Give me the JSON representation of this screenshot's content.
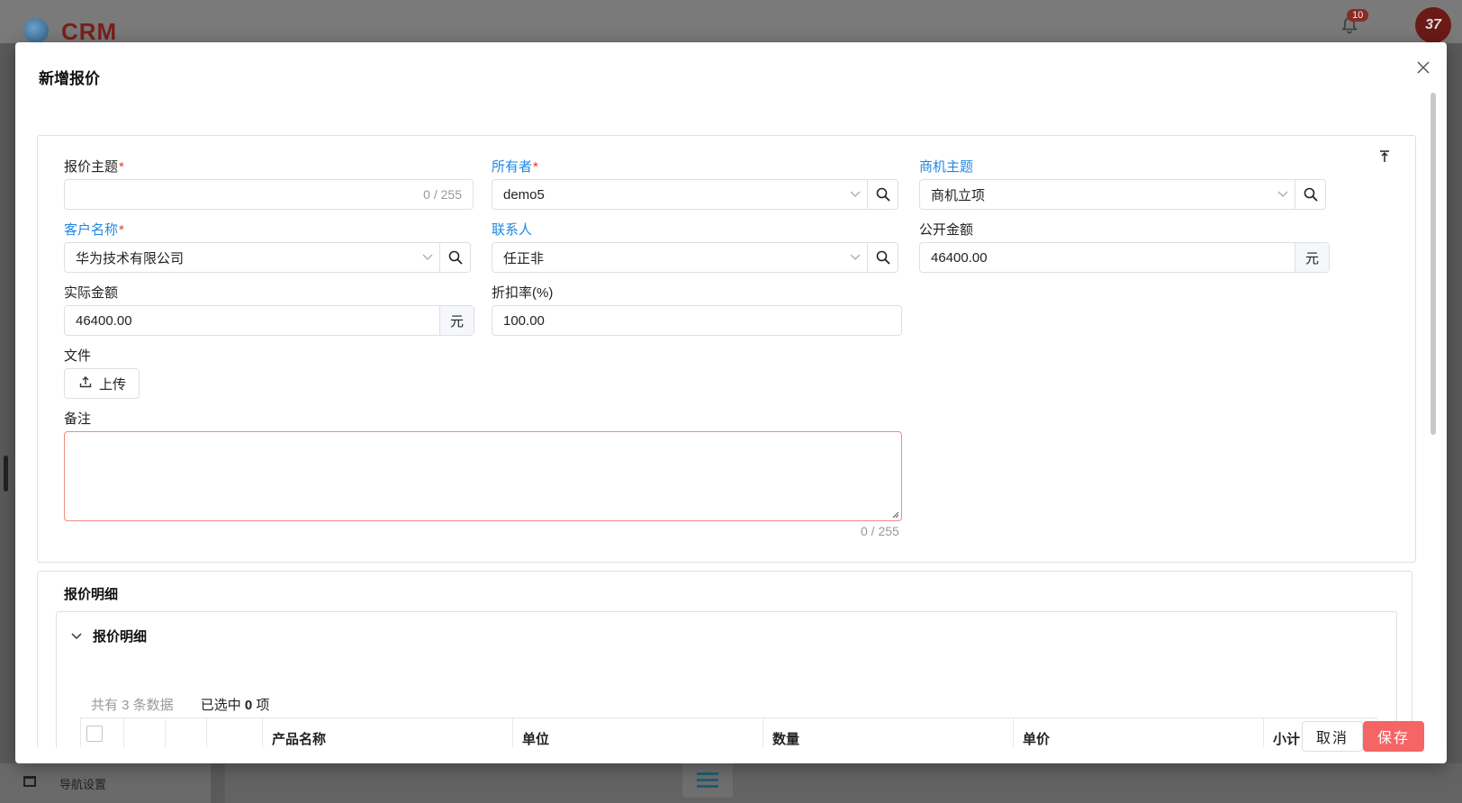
{
  "app": {
    "logo_text": "CRM",
    "notification_count": "10",
    "avatar_text": "37",
    "nav_settings_label": "导航设置"
  },
  "modal": {
    "title": "新增报价",
    "fields": {
      "subject": {
        "label": "报价主题",
        "required": "*",
        "value": "",
        "count": "0 / 255"
      },
      "owner": {
        "label": "所有者",
        "required": "*",
        "value": "demo5"
      },
      "opportunity": {
        "label": "商机主题",
        "value": "商机立项"
      },
      "customer": {
        "label": "客户名称",
        "required": "*",
        "value": "华为技术有限公司"
      },
      "contact": {
        "label": "联系人",
        "value": "任正非"
      },
      "public_amount": {
        "label": "公开金额",
        "value": "46400.00",
        "unit": "元"
      },
      "actual_amount": {
        "label": "实际金额",
        "value": "46400.00",
        "unit": "元"
      },
      "discount": {
        "label": "折扣率(%)",
        "value": "100.00"
      },
      "file": {
        "label": "文件",
        "upload_label": "上传"
      },
      "remark": {
        "label": "备注",
        "count": "0 / 255"
      }
    },
    "detail_section": {
      "title": "报价明细",
      "panel_title": "报价明细",
      "total_text": "共有 3 条数据",
      "selected_prefix": "已选中",
      "selected_count": "0",
      "selected_suffix": "项",
      "columns": [
        "产品名称",
        "单位",
        "数量",
        "单价",
        "小计"
      ]
    },
    "buttons": {
      "cancel": "取消",
      "save": "保存"
    }
  },
  "colors": {
    "accent_link": "#1e88e5",
    "required": "#e53935",
    "save_button": "#f56565"
  }
}
